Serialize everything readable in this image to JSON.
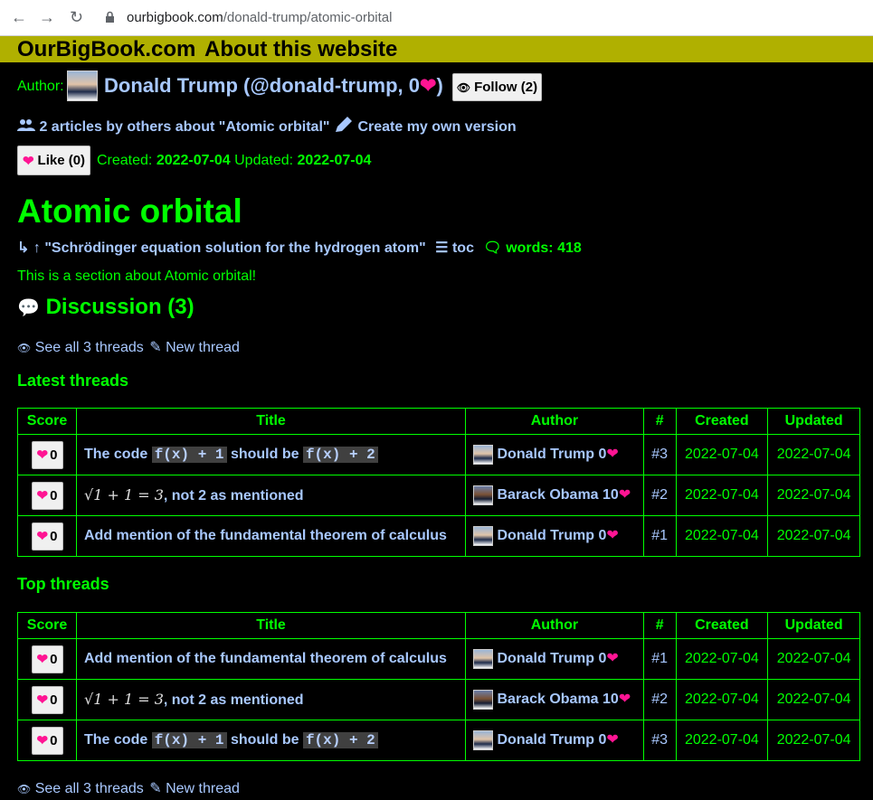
{
  "browser": {
    "host": "ourbigbook.com",
    "path": "/donald-trump/atomic-orbital"
  },
  "topnav": {
    "site": "OurBigBook.com",
    "about": "About this website"
  },
  "author_line": {
    "label": "Author:",
    "name": "Donald Trump (@donald-trump, 0",
    "close": ")",
    "follow": "Follow (2)"
  },
  "others_line": {
    "articles": "2 articles by others about \"Atomic orbital\"",
    "create": "Create my own version"
  },
  "meta_line": {
    "like": "Like (0)",
    "created_label": "Created:",
    "created": "2022-07-04",
    "updated_label": "Updated:",
    "updated": "2022-07-04"
  },
  "article": {
    "title": "Atomic orbital",
    "parent": "\"Schrödinger equation solution for the hydrogen atom\"",
    "toc": "toc",
    "words": "words: 418",
    "body": "This is a section about Atomic orbital!"
  },
  "discussion": {
    "heading": "Discussion (3)",
    "see_all": "See all 3 threads",
    "new_thread": "New thread"
  },
  "tables": {
    "headers": [
      "Score",
      "Title",
      "Author",
      "#",
      "Created",
      "Updated"
    ],
    "latest_heading": "Latest threads",
    "top_heading": "Top threads",
    "latest": [
      {
        "score": "0",
        "title_pre": "The code ",
        "code1": "f(x) + 1",
        "title_mid": " should be ",
        "code2": "f(x) + 2",
        "author": "Donald Trump 0",
        "avatar": "trump",
        "num": "#3",
        "created": "2022-07-04",
        "updated": "2022-07-04"
      },
      {
        "score": "0",
        "math": "√1 + 1 = 3",
        "title_post": ", not 2 as mentioned",
        "author": "Barack Obama 10",
        "avatar": "obama",
        "num": "#2",
        "created": "2022-07-04",
        "updated": "2022-07-04"
      },
      {
        "score": "0",
        "title_plain": "Add mention of the fundamental theorem of calculus",
        "author": "Donald Trump 0",
        "avatar": "trump",
        "num": "#1",
        "created": "2022-07-04",
        "updated": "2022-07-04"
      }
    ],
    "top": [
      {
        "score": "0",
        "title_plain": "Add mention of the fundamental theorem of calculus",
        "author": "Donald Trump 0",
        "avatar": "trump",
        "num": "#1",
        "created": "2022-07-04",
        "updated": "2022-07-04"
      },
      {
        "score": "0",
        "math": "√1 + 1 = 3",
        "title_post": ", not 2 as mentioned",
        "author": "Barack Obama 10",
        "avatar": "obama",
        "num": "#2",
        "created": "2022-07-04",
        "updated": "2022-07-04"
      },
      {
        "score": "0",
        "title_pre": "The code ",
        "code1": "f(x) + 1",
        "title_mid": " should be ",
        "code2": "f(x) + 2",
        "author": "Donald Trump 0",
        "avatar": "trump",
        "num": "#3",
        "created": "2022-07-04",
        "updated": "2022-07-04"
      }
    ]
  },
  "footer": {
    "see_all": "See all 3 threads",
    "new_thread": "New thread"
  },
  "colors": {
    "text": "#00ff00",
    "link": "#a8c8ff",
    "nav_bg": "#b0b000",
    "heart": "#ff1493"
  }
}
